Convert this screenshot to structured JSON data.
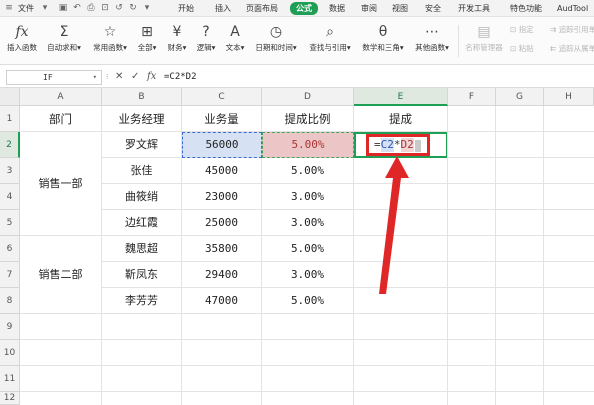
{
  "top_tabs": {
    "file": "文件",
    "items": [
      "开始",
      "插入",
      "页面布局",
      "公式",
      "数据",
      "审阅",
      "视图",
      "安全",
      "开发工具",
      "特色功能",
      "AudTool"
    ],
    "active": "公式"
  },
  "ribbon": {
    "buttons": [
      {
        "icon": "fx",
        "label": "插入函数"
      },
      {
        "icon": "Σ",
        "label": "自动求和▾"
      },
      {
        "icon": "☆",
        "label": "常用函数▾"
      },
      {
        "icon": "⊞",
        "label": "全部▾"
      },
      {
        "icon": "¥",
        "label": "财务▾"
      },
      {
        "icon": "?",
        "label": "逻辑▾"
      },
      {
        "icon": "A",
        "label": "文本▾"
      },
      {
        "icon": "◷",
        "label": "日期和时间▾"
      },
      {
        "icon": "⌕",
        "label": "查找与引用▾"
      },
      {
        "icon": "θ",
        "label": "数学和三角▾"
      },
      {
        "icon": "⋯",
        "label": "其他函数▾"
      }
    ],
    "disabled_buttons": [
      {
        "label": "名称管理器"
      },
      {
        "label": "指定"
      },
      {
        "label": "粘贴"
      },
      {
        "label": "追踪引用单"
      },
      {
        "label": "追踪从属单"
      }
    ]
  },
  "formula_bar": {
    "name_box": "IF",
    "cancel_symbol": "✕",
    "confirm_symbol": "✓",
    "fx_symbol": "fx",
    "content": "=C2*D2"
  },
  "grid": {
    "columns": [
      "A",
      "B",
      "C",
      "D",
      "E",
      "F",
      "G",
      "H"
    ],
    "rows": [
      "1",
      "2",
      "3",
      "4",
      "5",
      "6",
      "7",
      "8",
      "9",
      "10",
      "11",
      "12"
    ],
    "selected_column": "E",
    "selected_row": "2"
  },
  "table": {
    "headers": {
      "dept": "部门",
      "manager": "业务经理",
      "volume": "业务量",
      "rate": "提成比例",
      "commission": "提成"
    },
    "dept_groups": [
      "销售一部",
      "销售二部"
    ],
    "rows": [
      {
        "manager": "罗文辉",
        "volume": "56000",
        "rate": "5.00%"
      },
      {
        "manager": "张佳",
        "volume": "45000",
        "rate": "5.00%"
      },
      {
        "manager": "曲筱绡",
        "volume": "23000",
        "rate": "3.00%"
      },
      {
        "manager": "边红霞",
        "volume": "25000",
        "rate": "3.00%"
      },
      {
        "manager": "魏思超",
        "volume": "35800",
        "rate": "5.00%"
      },
      {
        "manager": "靳凤东",
        "volume": "29400",
        "rate": "3.00%"
      },
      {
        "manager": "李芳芳",
        "volume": "47000",
        "rate": "5.00%"
      }
    ]
  },
  "editing_formula": {
    "eq": "=",
    "ref1": "C2",
    "op": "*",
    "ref2": "D2"
  },
  "colors": {
    "accent": "#1f9f55",
    "annotation": "#e02727",
    "ref_blue": "#d7e1f4",
    "ref_red": "#ecc6c6"
  }
}
